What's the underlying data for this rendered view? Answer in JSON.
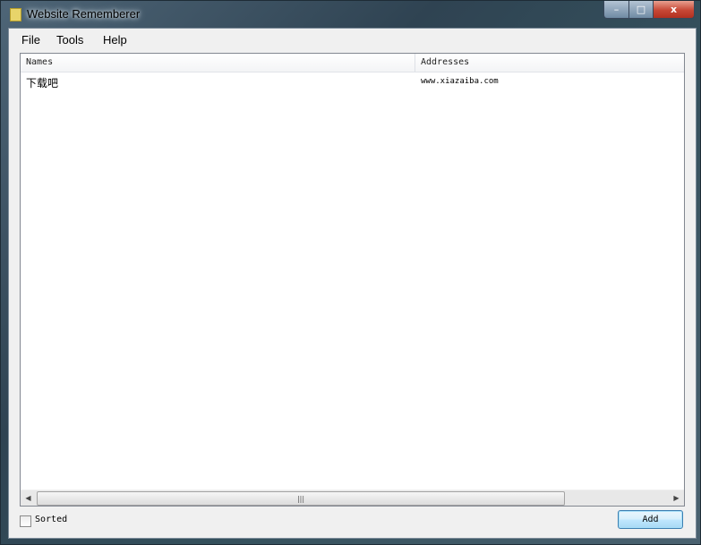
{
  "window": {
    "title": "Website Rememberer"
  },
  "titlebar_buttons": {
    "minimize": "–",
    "maximize": "□",
    "close": "x"
  },
  "menu": [
    "File",
    "Tools",
    "Help"
  ],
  "list": {
    "columns": [
      "Names",
      "Addresses"
    ],
    "rows": [
      {
        "name": "下载吧",
        "address": "www.xiazaiba.com"
      }
    ]
  },
  "scrollbar": {
    "left_arrow": "◀",
    "right_arrow": "▶",
    "grip": "|||"
  },
  "sorted_checkbox": {
    "label": "Sorted",
    "checked": false
  },
  "add_button": {
    "label": "Add"
  }
}
